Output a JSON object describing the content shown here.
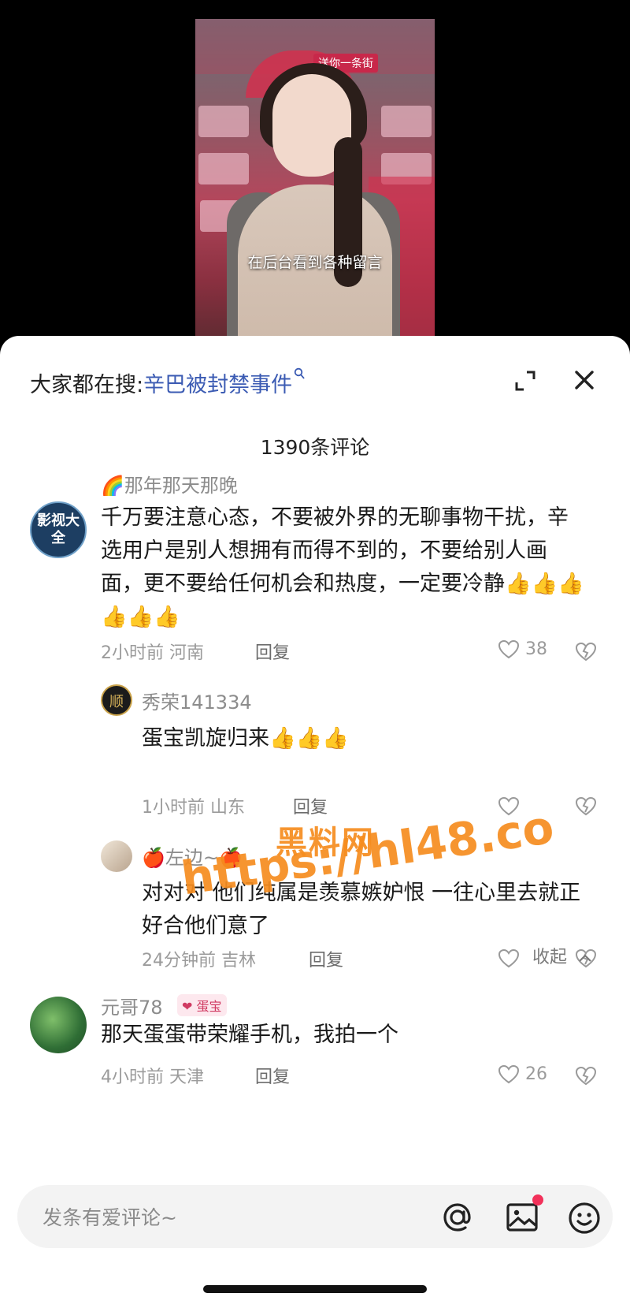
{
  "video": {
    "caption": "在后台看到各种留言",
    "store_sign": "送你一条街"
  },
  "search": {
    "prefix": "大家都在搜:",
    "term": "辛巴被封禁事件"
  },
  "comments_header": {
    "count_label": "1390条评论"
  },
  "comments": [
    {
      "username": "🌈那年那天那晚",
      "avatar_text": "影视大全",
      "text": "千万要注意心态，不要被外界的无聊事物干扰，辛选用户是别人想拥有而得不到的，不要给别人画面，更不要给任何机会和热度，一定要冷静👍👍👍👍👍👍",
      "time": "2小时前 河南",
      "reply_label": "回复",
      "likes": "38"
    },
    {
      "username": "秀荣141334",
      "avatar_text": "顺",
      "text": "蛋宝凯旋归来👍👍👍",
      "time": "1小时前 山东",
      "reply_label": "回复",
      "likes": ""
    },
    {
      "username": "🍎左边~🍎",
      "text": "对对对 他们纯属是羡慕嫉妒恨 一往心里去就正好合他们意了",
      "time": "24分钟前 吉林",
      "reply_label": "回复",
      "likes": ""
    },
    {
      "username": "元哥78",
      "badge": "蛋宝",
      "text": "那天蛋蛋带荣耀手机，我拍一个",
      "time": "4小时前 天津",
      "reply_label": "回复",
      "likes": "26"
    }
  ],
  "collapse_label": "收起",
  "watermark": {
    "line1": "黑料网",
    "line2": "https://hl48.co"
  },
  "input": {
    "placeholder": "发条有爱评论~"
  },
  "icons": [
    "expand-icon",
    "close-icon",
    "search-icon",
    "heart-icon",
    "broken-heart-icon",
    "at-icon",
    "image-icon",
    "smile-icon",
    "chevron-up-icon"
  ],
  "colors": {
    "accent_link": "#3b5bb3",
    "watermark": "#f58c1e",
    "badge": "#d03a62",
    "notify_dot": "#f2315a"
  }
}
